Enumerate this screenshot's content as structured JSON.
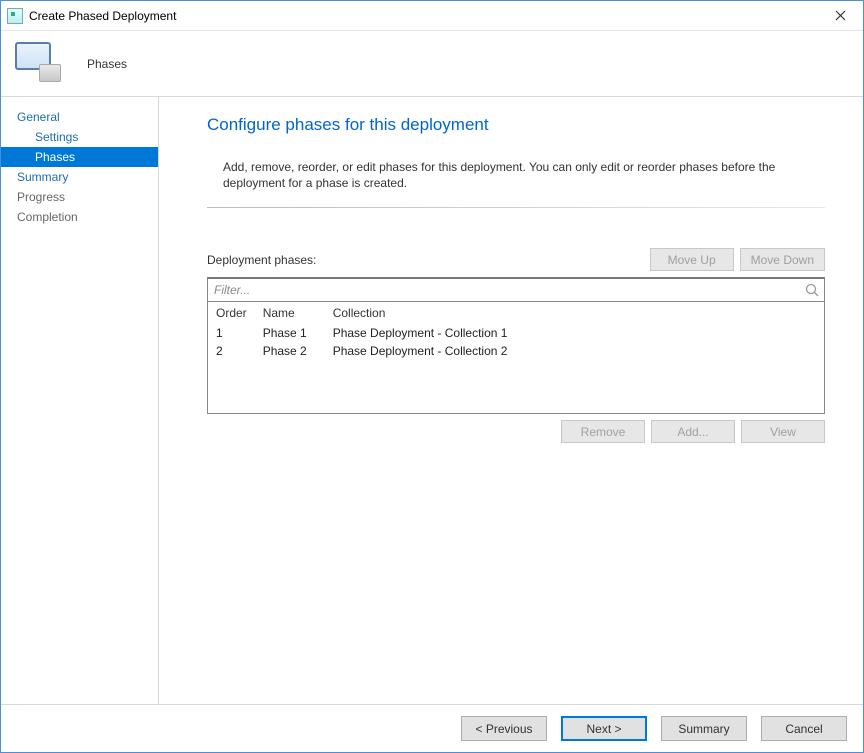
{
  "window": {
    "title": "Create Phased Deployment"
  },
  "banner": {
    "label": "Phases"
  },
  "nav": {
    "items": [
      {
        "label": "General",
        "kind": "top"
      },
      {
        "label": "Settings",
        "kind": "sub"
      },
      {
        "label": "Phases",
        "kind": "sub",
        "selected": true
      },
      {
        "label": "Summary",
        "kind": "top"
      },
      {
        "label": "Progress",
        "kind": "muted"
      },
      {
        "label": "Completion",
        "kind": "muted"
      }
    ]
  },
  "content": {
    "heading": "Configure phases for this deployment",
    "description": "Add, remove, reorder, or edit phases for this deployment. You can only edit or reorder phases before the deployment for a phase is created.",
    "phases_label": "Deployment phases:",
    "move_up": "Move Up",
    "move_down": "Move Down",
    "filter_placeholder": "Filter...",
    "columns": {
      "order": "Order",
      "name": "Name",
      "collection": "Collection"
    },
    "rows": [
      {
        "order": "1",
        "name": "Phase 1",
        "collection": "Phase Deployment - Collection 1"
      },
      {
        "order": "2",
        "name": "Phase 2",
        "collection": "Phase Deployment - Collection 2"
      }
    ],
    "remove": "Remove",
    "add": "Add...",
    "view": "View"
  },
  "footer": {
    "previous": "< Previous",
    "next": "Next >",
    "summary": "Summary",
    "cancel": "Cancel"
  }
}
